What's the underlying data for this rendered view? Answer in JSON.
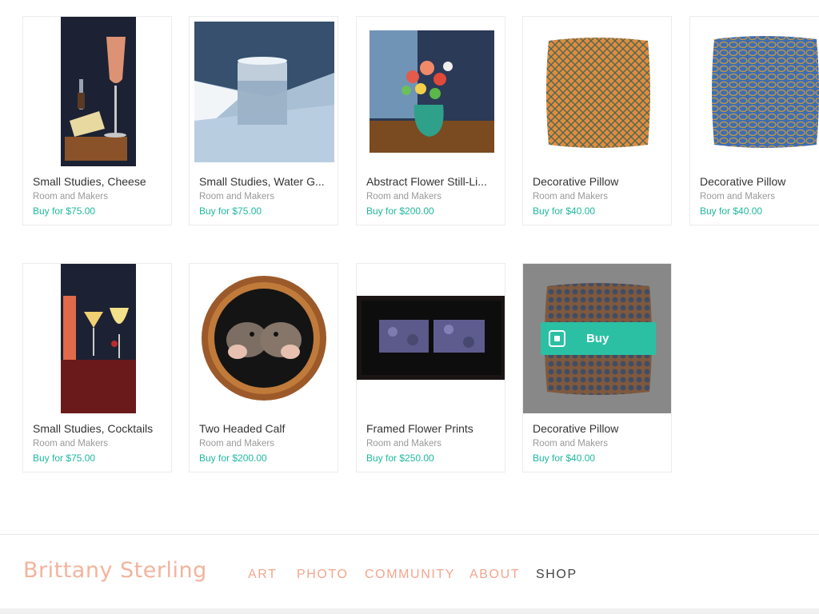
{
  "products": [
    {
      "title": "Small Studies, Cheese",
      "maker": "Room and Makers",
      "price": "Buy for $75.00",
      "image_icon": "painting-cheese-wine"
    },
    {
      "title": "Small Studies, Water G...",
      "maker": "Room and Makers",
      "price": "Buy for $75.00",
      "image_icon": "painting-water-glass"
    },
    {
      "title": "Abstract Flower Still-Li...",
      "maker": "Room and Makers",
      "price": "Buy for $200.00",
      "image_icon": "painting-flowers"
    },
    {
      "title": "Decorative Pillow",
      "maker": "Room and Makers",
      "price": "Buy for $40.00",
      "image_icon": "orange-pillow"
    },
    {
      "title": "Decorative Pillow",
      "maker": "Room and Makers",
      "price": "Buy for $40.00",
      "image_icon": "blue-pillow"
    },
    {
      "title": "Small Studies, Cocktails",
      "maker": "Room and Makers",
      "price": "Buy for $75.00",
      "image_icon": "painting-cocktails"
    },
    {
      "title": "Two Headed Calf",
      "maker": "Room and Makers",
      "price": "Buy for $200.00",
      "image_icon": "framed-calf"
    },
    {
      "title": "Framed Flower Prints",
      "maker": "Room and Makers",
      "price": "Buy for $250.00",
      "image_icon": "framed-prints"
    },
    {
      "title": "Decorative Pillow",
      "maker": "Room and Makers",
      "price": "Buy for $40.00",
      "image_icon": "blue-orange-pillow"
    }
  ],
  "hover_buy": {
    "label": "Buy",
    "icon": "square-logo-icon"
  },
  "footer": {
    "brand": "Brittany Sterling",
    "nav": [
      {
        "label": "ART",
        "active": false
      },
      {
        "label": "PHOTO",
        "active": false
      },
      {
        "label": "COMMUNITY",
        "active": false
      },
      {
        "label": "ABOUT",
        "active": false
      },
      {
        "label": "SHOP",
        "active": true
      }
    ]
  },
  "colors": {
    "accent": "#1fb89f",
    "buy_button": "#2bc0a4",
    "brand": "#f2b49e",
    "nav": "#f2a68d",
    "nav_active": "#444444"
  }
}
